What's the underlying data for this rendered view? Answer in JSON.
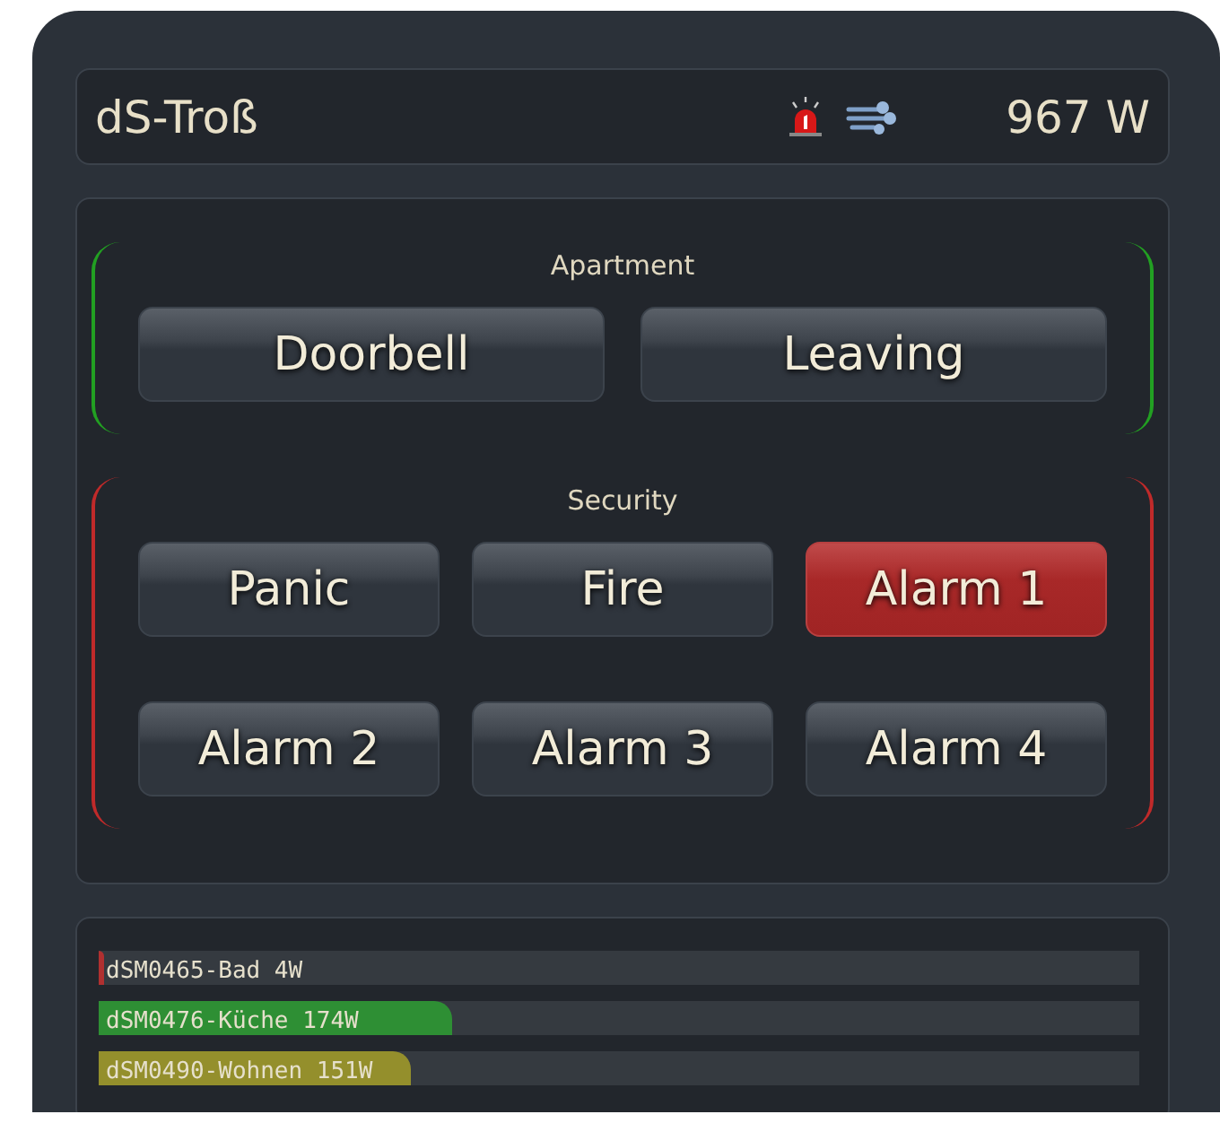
{
  "header": {
    "title": "dS-Troß",
    "power": "967 W"
  },
  "groups": [
    {
      "title": "Apartment",
      "color": "#22a022",
      "buttons": [
        {
          "label": "Doorbell",
          "active": false
        },
        {
          "label": "Leaving",
          "active": false
        }
      ]
    },
    {
      "title": "Security",
      "color": "#c02a2a",
      "buttons": [
        {
          "label": "Panic",
          "active": false
        },
        {
          "label": "Fire",
          "active": false
        },
        {
          "label": "Alarm 1",
          "active": true
        },
        {
          "label": "Alarm 2",
          "active": false
        },
        {
          "label": "Alarm 3",
          "active": false
        },
        {
          "label": "Alarm 4",
          "active": false
        }
      ]
    }
  ],
  "meters": [
    {
      "label": "dSM0465-Bad",
      "reading": "4W",
      "level": 0.005,
      "color": "#b03030"
    },
    {
      "label": "dSM0476-Küche",
      "reading": "174W",
      "level": 0.34,
      "color": "#2e8f34"
    },
    {
      "label": "dSM0490-Wohnen",
      "reading": "151W",
      "level": 0.3,
      "color": "#948f2c"
    }
  ]
}
